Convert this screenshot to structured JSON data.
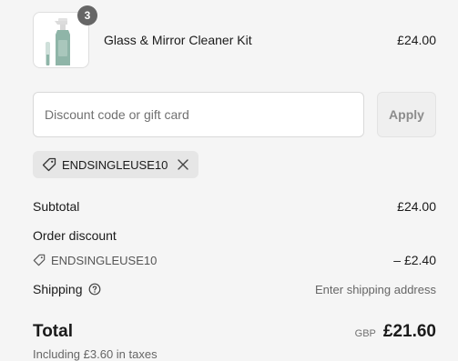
{
  "product": {
    "name": "Glass & Mirror Cleaner Kit",
    "price": "£24.00",
    "quantity": "3",
    "thumbnail_icon": "cleaner-spray-bottle-image"
  },
  "discount": {
    "placeholder": "Discount code or gift card",
    "value": "",
    "apply_label": "Apply",
    "applied_code": "ENDSINGLEUSE10",
    "remove_icon": "close-icon"
  },
  "summary": {
    "subtotal_label": "Subtotal",
    "subtotal_value": "£24.00",
    "order_discount_label": "Order discount",
    "discount_code": "ENDSINGLEUSE10",
    "discount_value": "– £2.40",
    "shipping_label": "Shipping",
    "shipping_value": "Enter shipping address",
    "total_label": "Total",
    "currency": "GBP",
    "total_value": "£21.60",
    "tax_note": "Including £3.60 in taxes"
  },
  "colors": {
    "background": "#f5f5f5",
    "badge": "#666666",
    "chip": "#e6e6e6",
    "bottle": "#8fb5a8"
  }
}
